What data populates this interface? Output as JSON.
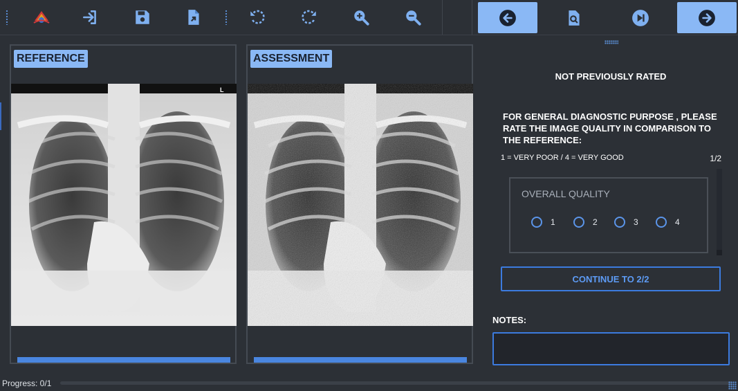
{
  "toolbar": {
    "buttons": [
      {
        "name": "app-logo-icon",
        "icon": "logo"
      },
      {
        "name": "login-icon",
        "icon": "sign-in"
      },
      {
        "name": "save-icon",
        "icon": "floppy-disk"
      },
      {
        "name": "export-file-icon",
        "icon": "file-arrow"
      },
      {
        "name": "rotate-left-icon",
        "icon": "rotate-ccw"
      },
      {
        "name": "rotate-right-icon",
        "icon": "rotate-cw"
      },
      {
        "name": "zoom-in-icon",
        "icon": "magnifier-plus"
      },
      {
        "name": "zoom-out-icon",
        "icon": "magnifier-minus"
      }
    ],
    "nav": [
      {
        "name": "previous-button",
        "icon": "arrow-left-circle",
        "highlighted": true
      },
      {
        "name": "search-file-button",
        "icon": "file-search",
        "highlighted": false
      },
      {
        "name": "skip-next-button",
        "icon": "skip-next-circle",
        "highlighted": false
      },
      {
        "name": "next-button",
        "icon": "arrow-right-circle",
        "highlighted": true
      }
    ]
  },
  "panels": {
    "reference": {
      "label": "REFERENCE",
      "marker": "L"
    },
    "assessment": {
      "label": "ASSESSMENT"
    }
  },
  "rating": {
    "status": "NOT PREVIOUSLY RATED",
    "question": "FOR GENERAL DIAGNOSTIC PURPOSE , PLEASE RATE THE IMAGE QUALITY IN COMPARISON TO THE REFERENCE:",
    "scale": "1 = VERY POOR  /  4 = VERY GOOD",
    "page": "1/2",
    "group_title": "OVERALL QUALITY",
    "options": [
      "1",
      "2",
      "3",
      "4"
    ],
    "selected": null,
    "continue_label": "CONTINUE TO 2/2",
    "notes_label": "NOTES:",
    "notes_value": ""
  },
  "progress": {
    "label": "Progress: 0/1",
    "fraction": 0
  },
  "colors": {
    "accent": "#8ab8f5",
    "border_blue": "#3c7bdf",
    "background": "#2c3036"
  }
}
